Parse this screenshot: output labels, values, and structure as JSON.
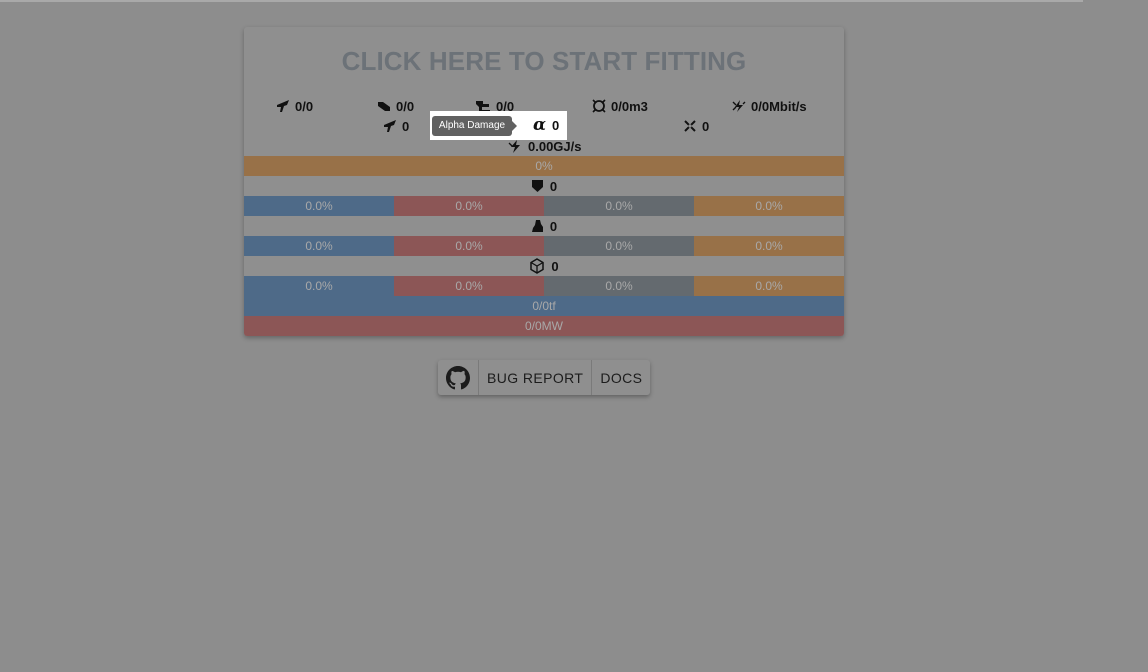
{
  "header": {
    "title": "CLICK HERE TO START FITTING"
  },
  "stats": {
    "high_slots": "0/0",
    "mid_slots": "0/0",
    "low_slots": "0/0",
    "drone_bay": "0/0m3",
    "drone_bandwidth": "0/0Mbit/s",
    "turret_hardpoints": "0",
    "alpha_damage": "0",
    "alpha_symbol": "α",
    "launcher_hardpoints": "0",
    "capacitor": "0.00GJ/s"
  },
  "tooltip": {
    "text": "Alpha Damage"
  },
  "capacitor_bar": {
    "value": "0%"
  },
  "shield": {
    "hp": "0",
    "resists": {
      "em": "0.0%",
      "thermal": "0.0%",
      "kinetic": "0.0%",
      "explosive": "0.0%"
    }
  },
  "armor": {
    "hp": "0",
    "resists": {
      "em": "0.0%",
      "thermal": "0.0%",
      "kinetic": "0.0%",
      "explosive": "0.0%"
    }
  },
  "hull": {
    "hp": "0",
    "resists": {
      "em": "0.0%",
      "thermal": "0.0%",
      "kinetic": "0.0%",
      "explosive": "0.0%"
    }
  },
  "cpu_bar": {
    "value": "0/0tf"
  },
  "power_bar": {
    "value": "0/0MW"
  },
  "footer_buttons": {
    "bug_report": "BUG REPORT",
    "docs": "DOCS"
  },
  "colors": {
    "em": "#4e6a88",
    "thermal": "#8c5656",
    "kinetic": "#646a6f",
    "explosive": "#987148",
    "capacitor": "#987148",
    "cpu": "#4e6a88",
    "power": "#8c5656"
  },
  "icons": [
    "high-slot-icon",
    "mid-slot-icon",
    "low-slot-icon",
    "drone-bay-icon",
    "drone-bandwidth-icon",
    "turret-icon",
    "launcher-icon",
    "capacitor-icon",
    "shield-icon",
    "armor-icon",
    "hull-icon",
    "github-icon"
  ]
}
